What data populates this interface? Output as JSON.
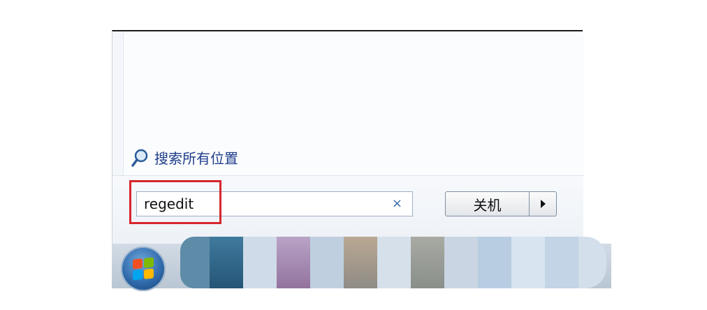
{
  "start_menu": {
    "search_all_label": "搜索所有位置",
    "search_box": {
      "value": "regedit",
      "clear_icon": "×"
    },
    "shutdown_label": "关机"
  },
  "taskbar": {
    "start_button": "windows-logo-icon"
  },
  "colors": {
    "highlight": "#d6262d",
    "link": "#1e3c8a"
  }
}
